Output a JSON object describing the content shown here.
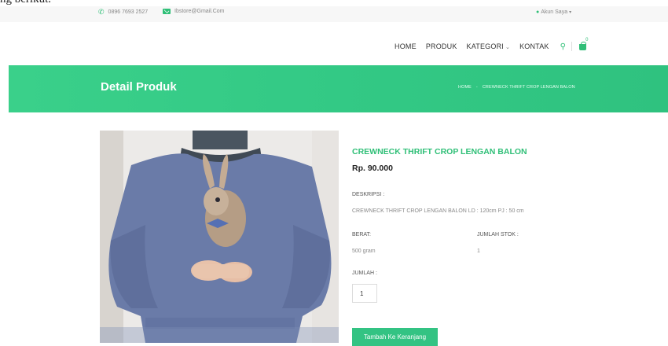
{
  "caption_fragment": "ng berikut.",
  "topbar": {
    "phone": "0896 7693 2527",
    "email": "Ibstore@Gmail.Com",
    "account": "Akun Saya"
  },
  "nav": {
    "items": [
      "HOME",
      "PRODUK",
      "KATEGORI",
      "KONTAK"
    ],
    "cart_count": "0"
  },
  "hero": {
    "title": "Detail Produk",
    "breadcrumb_home": "HOME",
    "breadcrumb_sep": "-",
    "breadcrumb_current": "CREWNECK THRIFT CROP LENGAN BALON"
  },
  "product": {
    "name": "CREWNECK THRIFT CROP LENGAN BALON",
    "price": "Rp. 90.000",
    "desc_label": "DESKRIPSI :",
    "desc": "CREWNECK THRIFT CROP LENGAN BALON LD : 120cm PJ : 50 cm",
    "weight_label": "BERAT:",
    "weight": "500 gram",
    "stock_label": "JUMLAH STOK :",
    "stock": "1",
    "qty_label": "JUMLAH :",
    "qty_value": "1",
    "add_button": "Tambah Ke Keranjang"
  },
  "colors": {
    "accent": "#2fbf77",
    "hero": "#35c984"
  },
  "icons": [
    "phone-icon",
    "mail-icon",
    "user-icon",
    "search-icon",
    "cart-icon",
    "chevron-down-icon"
  ]
}
